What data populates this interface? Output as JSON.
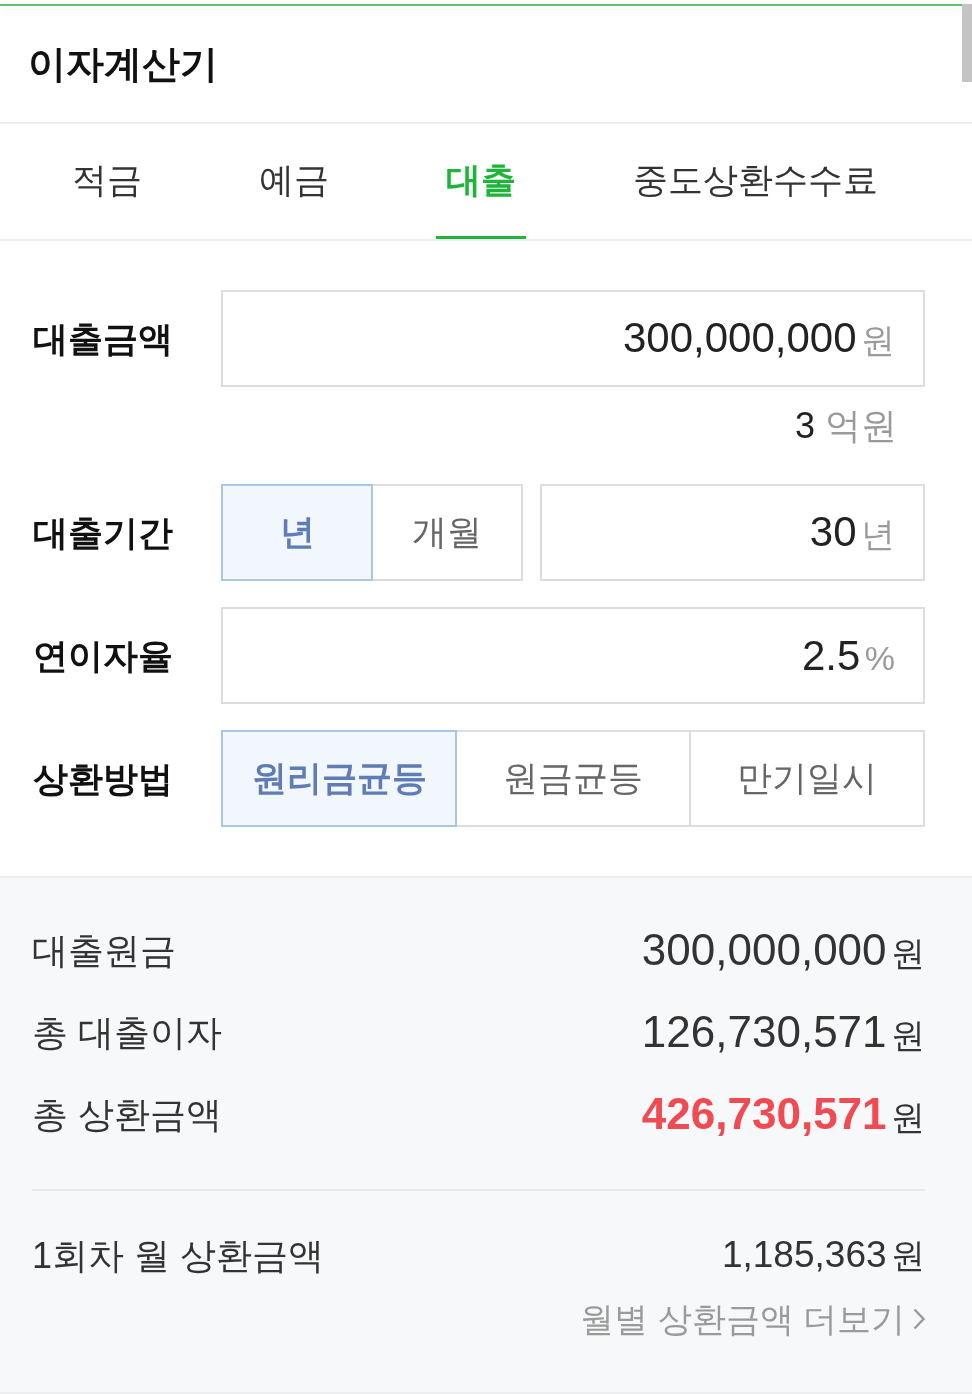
{
  "header": {
    "title": "이자계산기"
  },
  "tabs": [
    {
      "label": "적금",
      "selected": false
    },
    {
      "label": "예금",
      "selected": false
    },
    {
      "label": "대출",
      "selected": true
    },
    {
      "label": "중도상환수수료",
      "selected": false
    }
  ],
  "form": {
    "rows": [
      {
        "kind": "input",
        "label": "대출금액",
        "field": {
          "value": "300,000,000",
          "unit": "원"
        },
        "hint": {
          "number": "3",
          "unit": "억원"
        }
      },
      {
        "kind": "toggle_input",
        "label": "대출기간",
        "options": [
          {
            "label": "년",
            "selected": true
          },
          {
            "label": "개월",
            "selected": false
          }
        ],
        "field": {
          "value": "30",
          "unit": "년"
        }
      },
      {
        "kind": "input",
        "label": "연이자율",
        "field": {
          "value": "2.5",
          "unit": "%"
        }
      },
      {
        "kind": "options",
        "label": "상환방법",
        "options": [
          {
            "label": "원리금균등",
            "selected": true
          },
          {
            "label": "원금균등",
            "selected": false
          },
          {
            "label": "만기일시",
            "selected": false
          }
        ]
      }
    ]
  },
  "results": {
    "rows": [
      {
        "label": "대출원금",
        "value": "300,000,000",
        "unit": "원",
        "highlight": false
      },
      {
        "label": "총 대출이자",
        "value": "126,730,571",
        "unit": "원",
        "highlight": false
      },
      {
        "label": "총 상환금액",
        "value": "426,730,571",
        "unit": "원",
        "highlight": true
      }
    ],
    "monthly": {
      "label": "1회차 월 상환금액",
      "value": "1,185,363",
      "unit": "원"
    },
    "more_link": {
      "label": "월별 상환금액 더보기"
    }
  }
}
